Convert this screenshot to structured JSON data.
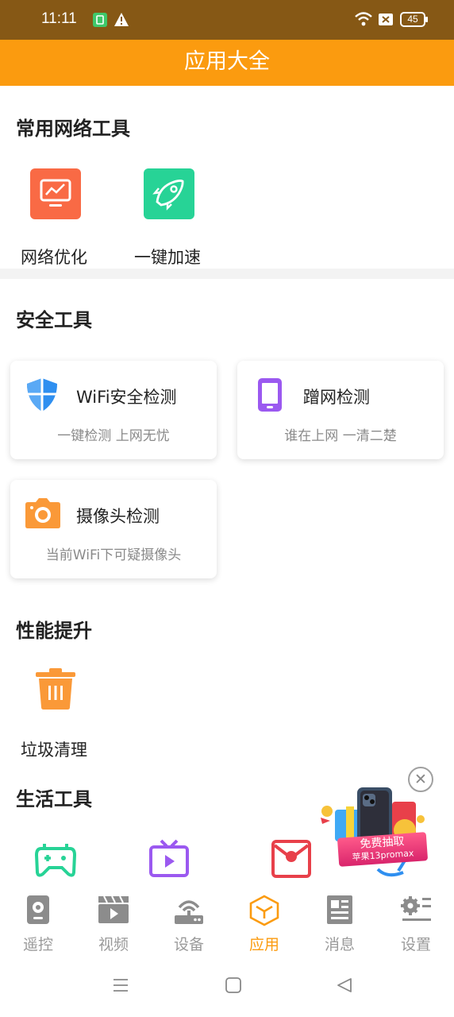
{
  "status_bar": {
    "time": "11:11",
    "battery": "45",
    "icons": [
      "sim-app-icon",
      "warning-icon",
      "wifi-icon",
      "sim-off-icon",
      "battery-icon"
    ]
  },
  "header": {
    "title": "应用大全"
  },
  "sections": {
    "network": {
      "title": "常用网络工具",
      "items": [
        {
          "label": "网络优化",
          "icon": "monitor-chart-icon",
          "color": "#f96a45"
        },
        {
          "label": "一键加速",
          "icon": "rocket-icon",
          "color": "#27d396"
        }
      ]
    },
    "security": {
      "title": "安全工具",
      "cards": [
        {
          "title": "WiFi安全检测",
          "subtitle": "一键检测 上网无忧",
          "icon": "shield-icon",
          "color": "#2f8ff0"
        },
        {
          "title": "蹭网检测",
          "subtitle": "谁在上网 一清二楚",
          "icon": "phone-icon",
          "color": "#9b59f0"
        },
        {
          "title": "摄像头检测",
          "subtitle": "当前WiFi下可疑摄像头",
          "icon": "camera-icon",
          "color": "#fa9938"
        }
      ]
    },
    "performance": {
      "title": "性能提升",
      "items": [
        {
          "label": "垃圾清理",
          "icon": "trash-icon",
          "color": "#fa9938"
        }
      ]
    },
    "life": {
      "title": "生活工具",
      "icons": [
        {
          "icon": "gamepad-icon",
          "color": "#27d396"
        },
        {
          "icon": "tv-icon",
          "color": "#9b59f0"
        },
        {
          "icon": "red-envelope-icon",
          "color": "#e8404a"
        },
        {
          "icon": "broom-icon",
          "color": "#2f8ff0"
        }
      ]
    }
  },
  "promo": {
    "line1": "免费抽取",
    "line2": "苹果13promax",
    "close_icon": "close-icon"
  },
  "tab_bar": {
    "tabs": [
      {
        "label": "遥控",
        "icon": "remote-icon",
        "active": false
      },
      {
        "label": "视频",
        "icon": "video-icon",
        "active": false
      },
      {
        "label": "设备",
        "icon": "router-icon",
        "active": false
      },
      {
        "label": "应用",
        "icon": "apps-cube-icon",
        "active": true
      },
      {
        "label": "消息",
        "icon": "news-icon",
        "active": false
      },
      {
        "label": "设置",
        "icon": "settings-icon",
        "active": false
      }
    ],
    "active_color": "#fb9b0f",
    "inactive_color": "#9a9a9a"
  },
  "system_nav": {
    "icons": [
      "menu-icon",
      "home-icon",
      "back-icon"
    ]
  },
  "colors": {
    "header": "#fb9b0f",
    "status_bar": "#865815"
  }
}
